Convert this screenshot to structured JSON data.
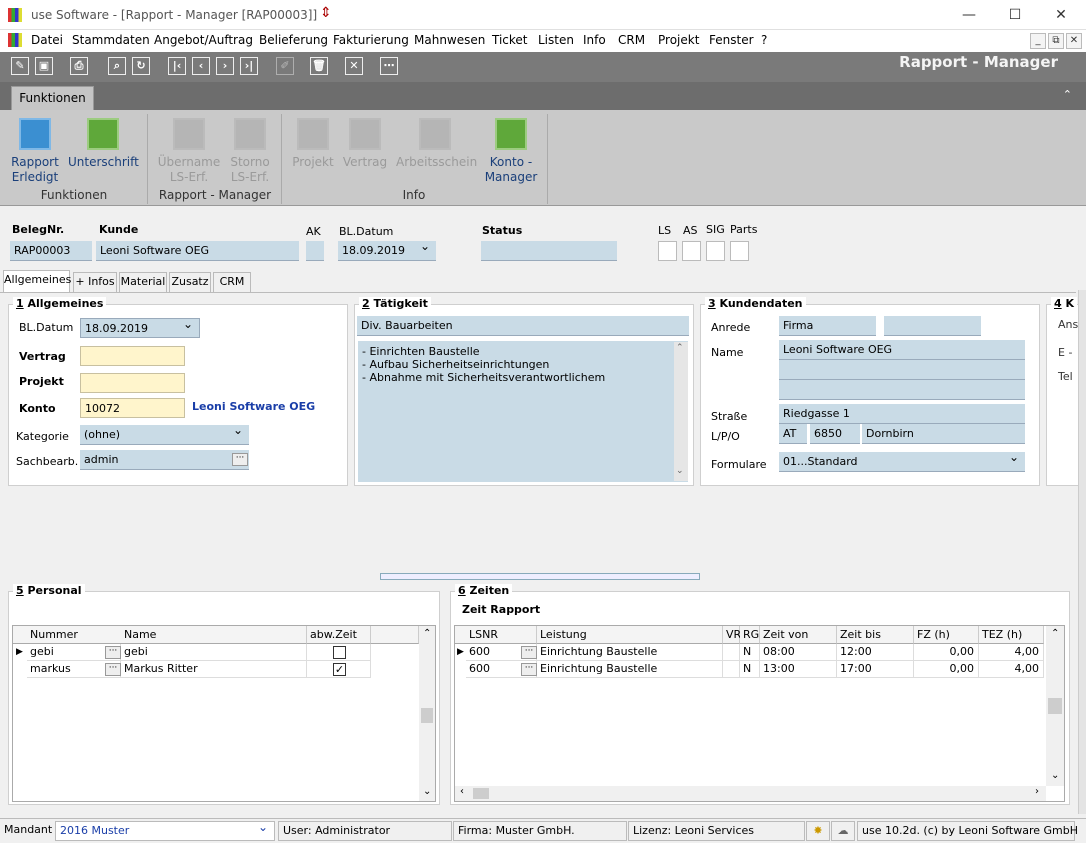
{
  "window": {
    "title": "use Software - [Rapport - Manager [RAP00003]]"
  },
  "menu": [
    "Datei",
    "Stammdaten",
    "Angebot/Auftrag",
    "Belieferung",
    "Fakturierung",
    "Mahnwesen",
    "Ticket",
    "Listen",
    "Info",
    "CRM",
    "Projekt",
    "Fenster",
    "?"
  ],
  "toolbar": {
    "module_title": "Rapport - Manager"
  },
  "ribbon": {
    "tab": "Funktionen",
    "buttons": {
      "rapport_erledigt": [
        "Rapport",
        "Erledigt"
      ],
      "unterschrift": [
        "Unterschrift"
      ],
      "ubername": [
        "Übername",
        "LS-Erf."
      ],
      "storno": [
        "Storno",
        "LS-Erf."
      ],
      "projekt": [
        "Projekt"
      ],
      "vertrag": [
        "Vertrag"
      ],
      "arbeitsschein": [
        "Arbeitsschein"
      ],
      "konto_manager": [
        "Konto -",
        "Manager"
      ]
    },
    "groups": {
      "funktionen": "Funktionen",
      "rapport_manager": "Rapport - Manager",
      "info": "Info"
    },
    "colors": {
      "rapport": "#3b8fd1",
      "unterschrift": "#5fa83a",
      "konto": "#5fa83a"
    }
  },
  "header": {
    "belegnr_label": "BelegNr.",
    "belegnr": "RAP00003",
    "kunde_label": "Kunde",
    "kunde": "Leoni Software OEG",
    "ak_label": "AK",
    "bldatum_label": "BL.Datum",
    "bldatum": "18.09.2019",
    "status_label": "Status",
    "ls": "LS",
    "as": "AS",
    "sig": "SIG",
    "parts": "Parts"
  },
  "tabs": [
    "Allgemeines",
    "+ Infos",
    "Material",
    "Zusatz",
    "CRM"
  ],
  "allgemeines": {
    "title_num": "1",
    "title": " Allgemeines",
    "bldatum_label": "BL.Datum",
    "bldatum": "18.09.2019",
    "vertrag_label": "Vertrag",
    "projekt_label": "Projekt",
    "konto_label": "Konto",
    "konto": "10072",
    "konto_name": "Leoni Software OEG",
    "kategorie_label": "Kategorie",
    "kategorie": "(ohne)",
    "sachbearb_label": "Sachbearb.",
    "sachbearb": "admin"
  },
  "taetigkeit": {
    "title_num": "2",
    "title": " Tätigkeit",
    "summary": "Div. Bauarbeiten",
    "lines": [
      "- Einrichten Baustelle",
      "- Aufbau Sicherheitseinrichtungen",
      "- Abnahme mit Sicherheitsverantwortlichem"
    ]
  },
  "kundendaten": {
    "title_num": "3",
    "title": " Kundendaten",
    "anrede_label": "Anrede",
    "anrede": "Firma",
    "name_label": "Name",
    "name": "Leoni Software OEG",
    "strasse_label": "Straße",
    "strasse": "Riedgasse 1",
    "lpo_label": "L/P/O",
    "land": "AT",
    "plz": "6850",
    "ort": "Dornbirn",
    "formulare_label": "Formulare",
    "formulare": "01...Standard"
  },
  "panel4": {
    "title_num": "4",
    "title": " K",
    "l1": "Ans",
    "l2": "E -",
    "l3": "Tel"
  },
  "personal": {
    "title_num": "5",
    "title": " Personal",
    "columns": [
      "Nummer",
      "Name",
      "abw.Zeit"
    ],
    "rows": [
      {
        "nummer": "gebi",
        "name": "gebi",
        "abw": ""
      },
      {
        "nummer": "markus",
        "name": "Markus Ritter",
        "abw": "✓"
      }
    ]
  },
  "zeiten": {
    "title_num": "6",
    "title": " Zeiten",
    "subtitle": "Zeit Rapport",
    "columns": [
      "LSNR",
      "Leistung",
      "VR",
      "RG",
      "Zeit von",
      "Zeit bis",
      "FZ (h)",
      "TEZ (h)"
    ],
    "rows": [
      {
        "lsnr": "600",
        "leistung": "Einrichtung Baustelle",
        "vr": "",
        "rg": "N",
        "von": "08:00",
        "bis": "12:00",
        "fz": "0,00",
        "tez": "4,00"
      },
      {
        "lsnr": "600",
        "leistung": "Einrichtung Baustelle",
        "vr": "",
        "rg": "N",
        "von": "13:00",
        "bis": "17:00",
        "fz": "0,00",
        "tez": "4,00"
      }
    ]
  },
  "statusbar": {
    "mandant_label": "Mandant",
    "mandant": "2016 Muster",
    "user": "User: Administrator",
    "firma": "Firma: Muster GmbH.",
    "lizenz": "Lizenz: Leoni Services",
    "version": "use 10.2d. (c) by Leoni Software GmbH"
  }
}
